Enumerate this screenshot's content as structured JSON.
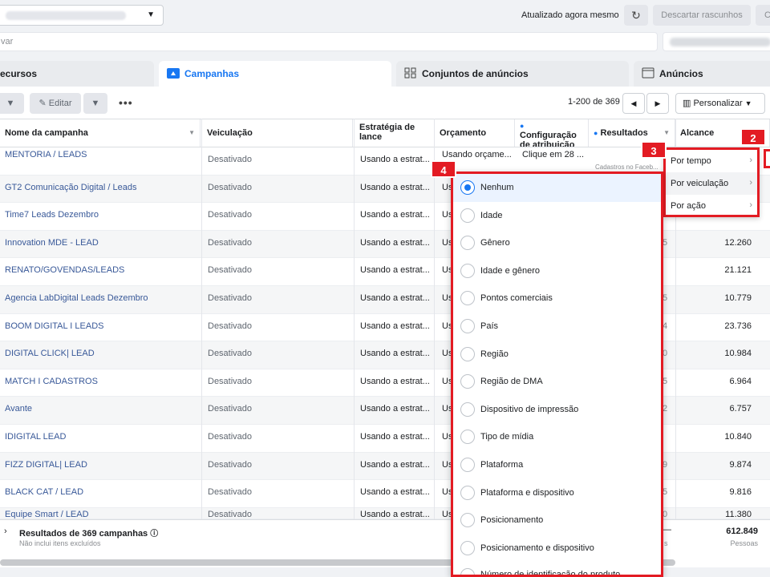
{
  "header": {
    "updated": "Atualizado agora mesmo",
    "discard": "Descartar rascunhos",
    "c_button": "C"
  },
  "search": {
    "placeholder": "var"
  },
  "tabs": [
    {
      "label": "ecursos"
    },
    {
      "label": "Campanhas"
    },
    {
      "label": "Conjuntos de anúncios"
    },
    {
      "label": "Anúncios"
    }
  ],
  "toolbar": {
    "edit": "Editar",
    "more": "•••",
    "range": "1-200 de 369",
    "customize": "Personalizar"
  },
  "columns": {
    "name": "Nome da campanha",
    "delivery": "Veiculação",
    "strategy": "Estratégia de lance",
    "budget": "Orçamento",
    "attribution": "Configuração de atribuição",
    "results": "Resultados",
    "reach": "Alcance"
  },
  "first_row": {
    "attribution": "Clique em 28 ...",
    "results_sub": "Cadastros no Faceb..."
  },
  "rows": [
    {
      "name": "MENTORIA / LEADS",
      "delivery": "Desativado",
      "strategy": "Usando a estrat...",
      "budget": "Usando orçame...",
      "reach": "",
      "partial": ""
    },
    {
      "name": "GT2 Comunicação Digital / Leads",
      "delivery": "Desativado",
      "strategy": "Usando a estrat...",
      "budget": "Us",
      "reach": "",
      "partial": ""
    },
    {
      "name": "Time7 Leads Dezembro",
      "delivery": "Desativado",
      "strategy": "Usando a estrat...",
      "budget": "Us",
      "reach": "",
      "partial": ""
    },
    {
      "name": "Innovation MDE - LEAD",
      "delivery": "Desativado",
      "strategy": "Usando a estrat...",
      "budget": "Us",
      "reach": "12.260",
      "partial": "5"
    },
    {
      "name": "RENATO/GOVENDAS/LEADS",
      "delivery": "Desativado",
      "strategy": "Usando a estrat...",
      "budget": "Us",
      "reach": "21.121",
      "partial": ""
    },
    {
      "name": "Agencia LabDigital Leads Dezembro",
      "delivery": "Desativado",
      "strategy": "Usando a estrat...",
      "budget": "Us",
      "reach": "10.779",
      "partial": "5"
    },
    {
      "name": "BOOM DIGITAL I LEADS",
      "delivery": "Desativado",
      "strategy": "Usando a estrat...",
      "budget": "Us",
      "reach": "23.736",
      "partial": "4"
    },
    {
      "name": "DIGITAL CLICK| LEAD",
      "delivery": "Desativado",
      "strategy": "Usando a estrat...",
      "budget": "Us",
      "reach": "10.984",
      "partial": "0"
    },
    {
      "name": "MATCH I CADASTROS",
      "delivery": "Desativado",
      "strategy": "Usando a estrat...",
      "budget": "Us",
      "reach": "6.964",
      "partial": "5"
    },
    {
      "name": "Avante",
      "delivery": "Desativado",
      "strategy": "Usando a estrat...",
      "budget": "Us",
      "reach": "6.757",
      "partial": "2"
    },
    {
      "name": "IDIGITAL LEAD",
      "delivery": "Desativado",
      "strategy": "Usando a estrat...",
      "budget": "Us",
      "reach": "10.840",
      "partial": ""
    },
    {
      "name": "FIZZ DIGITAL| LEAD",
      "delivery": "Desativado",
      "strategy": "Usando a estrat...",
      "budget": "Us",
      "reach": "9.874",
      "partial": "9"
    },
    {
      "name": "BLACK CAT / LEAD",
      "delivery": "Desativado",
      "strategy": "Usando a estrat...",
      "budget": "Us",
      "reach": "9.816",
      "partial": "5"
    },
    {
      "name": "Equipe Smart / LEAD",
      "delivery": "Desativado",
      "strategy": "Usando a estrat...",
      "budget": "Us",
      "reach": "11.380",
      "partial": "0"
    }
  ],
  "footer": {
    "title": "Resultados de 369 campanhas",
    "note": "Não inclui itens excluídos",
    "reach_total": "612.849",
    "reach_unit": "Pessoas",
    "dash": "—",
    "partial": "s"
  },
  "breakdown_menu": [
    {
      "label": "Por tempo"
    },
    {
      "label": "Por veiculação"
    },
    {
      "label": "Por ação"
    }
  ],
  "breakdown_options": [
    {
      "label": "Nenhum",
      "selected": true
    },
    {
      "label": "Idade"
    },
    {
      "label": "Gênero"
    },
    {
      "label": "Idade e gênero"
    },
    {
      "label": "Pontos comerciais"
    },
    {
      "label": "País"
    },
    {
      "label": "Região"
    },
    {
      "label": "Região de DMA"
    },
    {
      "label": "Dispositivo de impressão"
    },
    {
      "label": "Tipo de mídia"
    },
    {
      "label": "Plataforma"
    },
    {
      "label": "Plataforma e dispositivo"
    },
    {
      "label": "Posicionamento"
    },
    {
      "label": "Posicionamento e dispositivo"
    },
    {
      "label": "Número de identificação do produto"
    }
  ],
  "callouts": [
    "2",
    "3",
    "4"
  ],
  "colors": {
    "accent": "#1877f2",
    "callout": "#e31b23",
    "link": "#385898"
  }
}
